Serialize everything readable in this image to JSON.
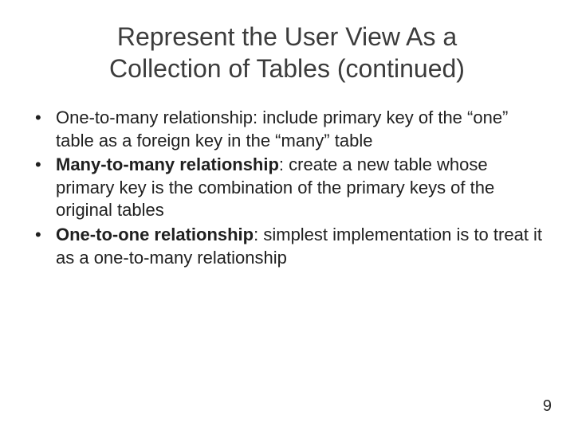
{
  "title": "Represent the User View As a Collection of Tables (continued)",
  "bullets": [
    {
      "lead": "One-to-many relationship",
      "lead_bold": false,
      "rest": ": include primary key of the “one” table as a foreign key in the “many” table"
    },
    {
      "lead": "Many-to-many relationship",
      "lead_bold": true,
      "rest": ": create a new table whose primary key is the combination of the primary keys of the original tables"
    },
    {
      "lead": "One-to-one relationship",
      "lead_bold": true,
      "rest": ": simplest implementation is to treat it as a one-to-many relationship"
    }
  ],
  "page_number": "9"
}
